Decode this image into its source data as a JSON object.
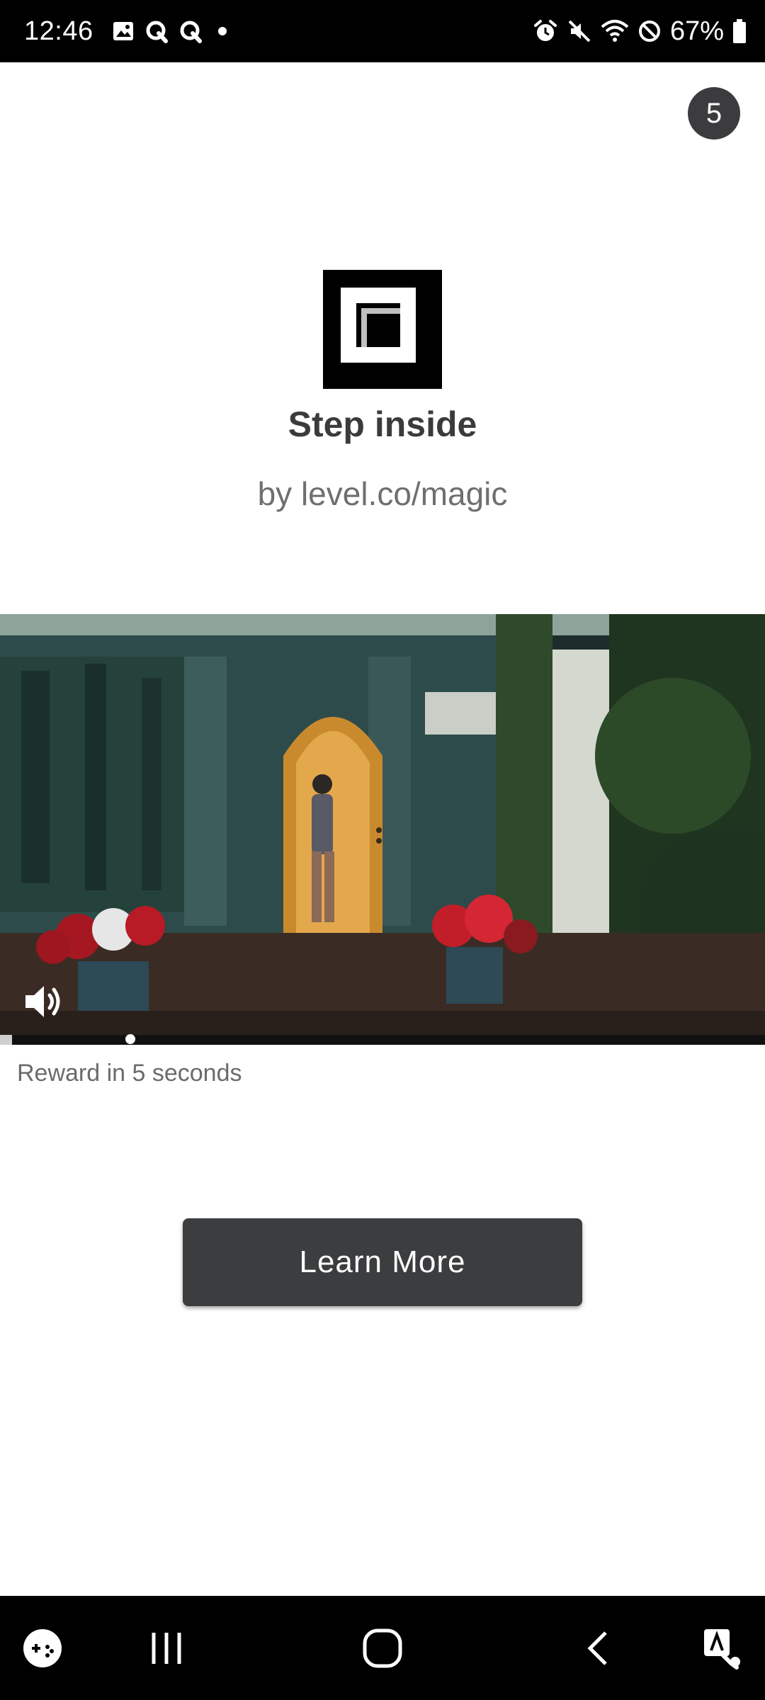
{
  "status_bar": {
    "time": "12:46",
    "battery_percent": "67%",
    "left_icons": [
      "gallery-icon",
      "q-app-icon",
      "q-app-icon",
      "dot-icon"
    ],
    "right_icons": [
      "alarm-icon",
      "mute-icon",
      "wifi-icon",
      "do-not-disturb-icon",
      "battery-icon"
    ]
  },
  "countdown": {
    "value": "5"
  },
  "ad": {
    "title": "Step inside",
    "subtitle": "by level.co/magic",
    "logo_icon": "level-logo-icon"
  },
  "video": {
    "progress": 0.17,
    "muted": false,
    "sound_icon": "volume-icon"
  },
  "reward": {
    "text": "Reward in 5 seconds"
  },
  "cta": {
    "label": "Learn More"
  },
  "nav_bar": {
    "buttons": [
      "game-launcher-icon",
      "recent-apps-icon",
      "home-icon",
      "back-icon",
      "accessibility-icon"
    ]
  },
  "colors": {
    "button_bg": "#3c3d3f",
    "badge_bg": "#3c3c3e",
    "title_text": "#3b3b3d",
    "subtitle_text": "#6f6f72"
  }
}
